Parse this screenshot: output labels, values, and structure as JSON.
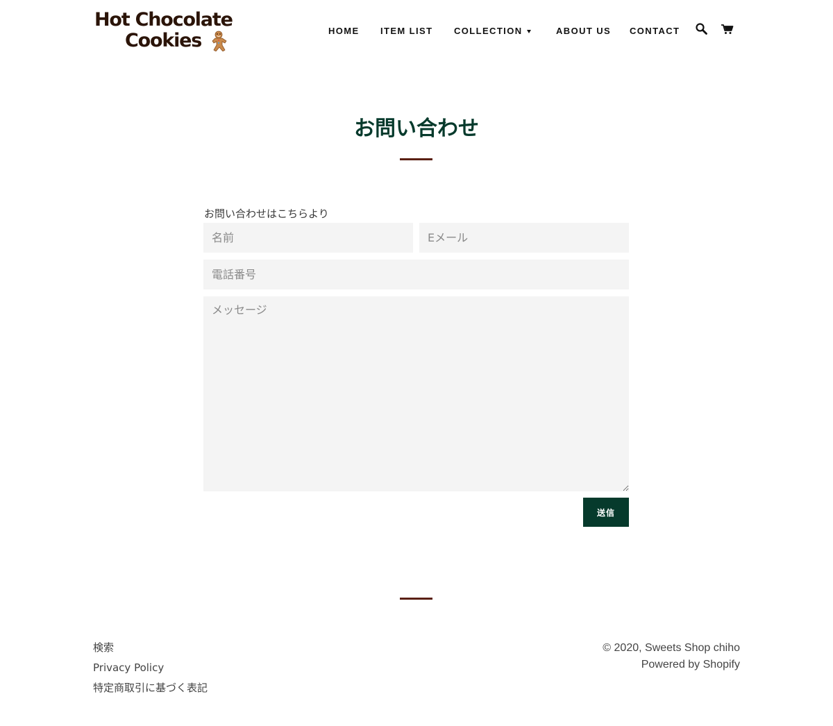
{
  "header": {
    "logo": {
      "line1": "Hot Chocolate",
      "line2": "Cookies",
      "image_icon": "gingerbread-man-icon"
    },
    "nav": [
      {
        "label": "HOME"
      },
      {
        "label": "ITEM LIST"
      },
      {
        "label": "COLLECTION",
        "has_dropdown": true
      },
      {
        "label": "ABOUT US"
      },
      {
        "label": "CONTACT"
      }
    ],
    "icons": {
      "search": "search-icon",
      "cart": "cart-icon"
    }
  },
  "main": {
    "title": "お問い合わせ",
    "form": {
      "intro": "お問い合わせはこちらより",
      "name_placeholder": "名前",
      "email_placeholder": "Eメール",
      "phone_placeholder": "電話番号",
      "message_placeholder": "メッセージ",
      "submit_label": "送信"
    }
  },
  "footer": {
    "links": [
      {
        "label": "検索"
      },
      {
        "label": "Privacy Policy"
      },
      {
        "label": "特定商取引に基づく表記"
      }
    ],
    "copyright": "© 2020, Sweets Shop chiho",
    "powered_by": "Powered by Shopify"
  },
  "colors": {
    "accent": "#063a2c",
    "rule": "#5a1f12",
    "field_bg": "#f4f4f4",
    "logo_text": "#2b1408"
  }
}
